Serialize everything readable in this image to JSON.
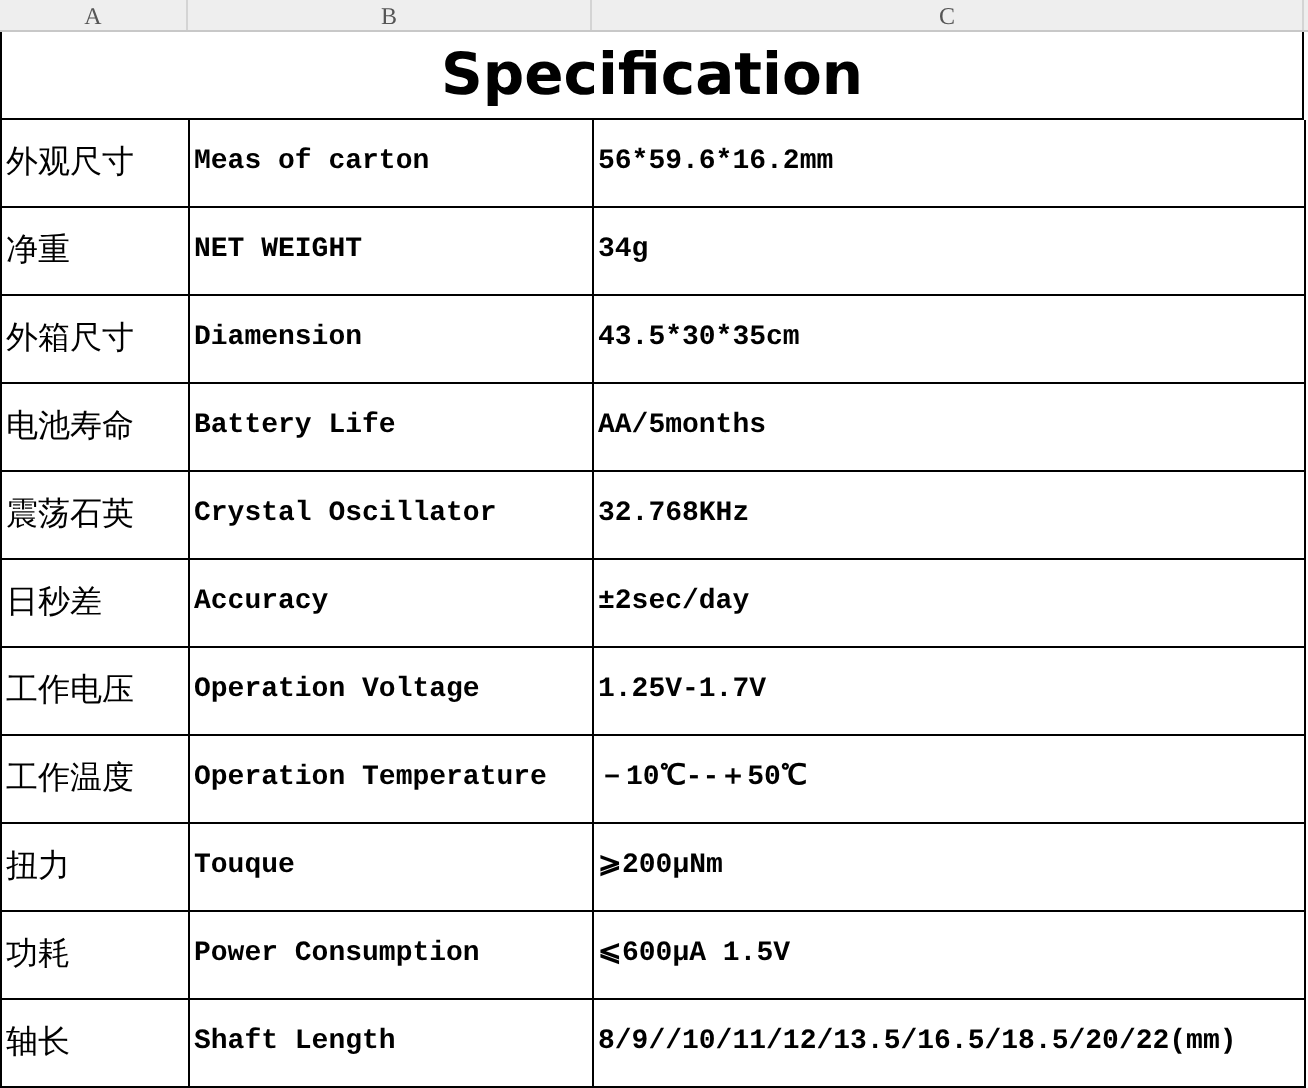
{
  "column_headers": [
    "A",
    "B",
    "C"
  ],
  "title": "Specification",
  "rows": [
    {
      "cells": [
        "外观尺寸",
        "Meas of carton",
        "56*59.6*16.2mm"
      ]
    },
    {
      "cells": [
        "净重",
        "NET WEIGHT",
        "34g"
      ]
    },
    {
      "cells": [
        "外箱尺寸",
        "Diamension",
        "43.5*30*35cm"
      ]
    },
    {
      "cells": [
        "电池寿命",
        "Battery Life",
        "AA/5months"
      ]
    },
    {
      "cells": [
        "震荡石英",
        "Crystal Oscillator",
        "32.768KHz"
      ]
    },
    {
      "cells": [
        "日秒差",
        "Accuracy",
        "±2sec/day"
      ]
    },
    {
      "cells": [
        "工作电压",
        "Operation Voltage",
        "1.25V-1.7V"
      ]
    },
    {
      "cells": [
        "工作温度",
        "Operation Temperature",
        "－10℃--＋50℃"
      ]
    },
    {
      "cells": [
        "扭力",
        "Touque",
        "⩾200μNm"
      ]
    },
    {
      "cells": [
        "功耗",
        "Power Consumption",
        "⩽600μA 1.5V"
      ]
    },
    {
      "cells": [
        "轴长",
        "Shaft Length",
        "8/9//10/11/12/13.5/16.5/18.5/20/22(mm)"
      ]
    }
  ]
}
